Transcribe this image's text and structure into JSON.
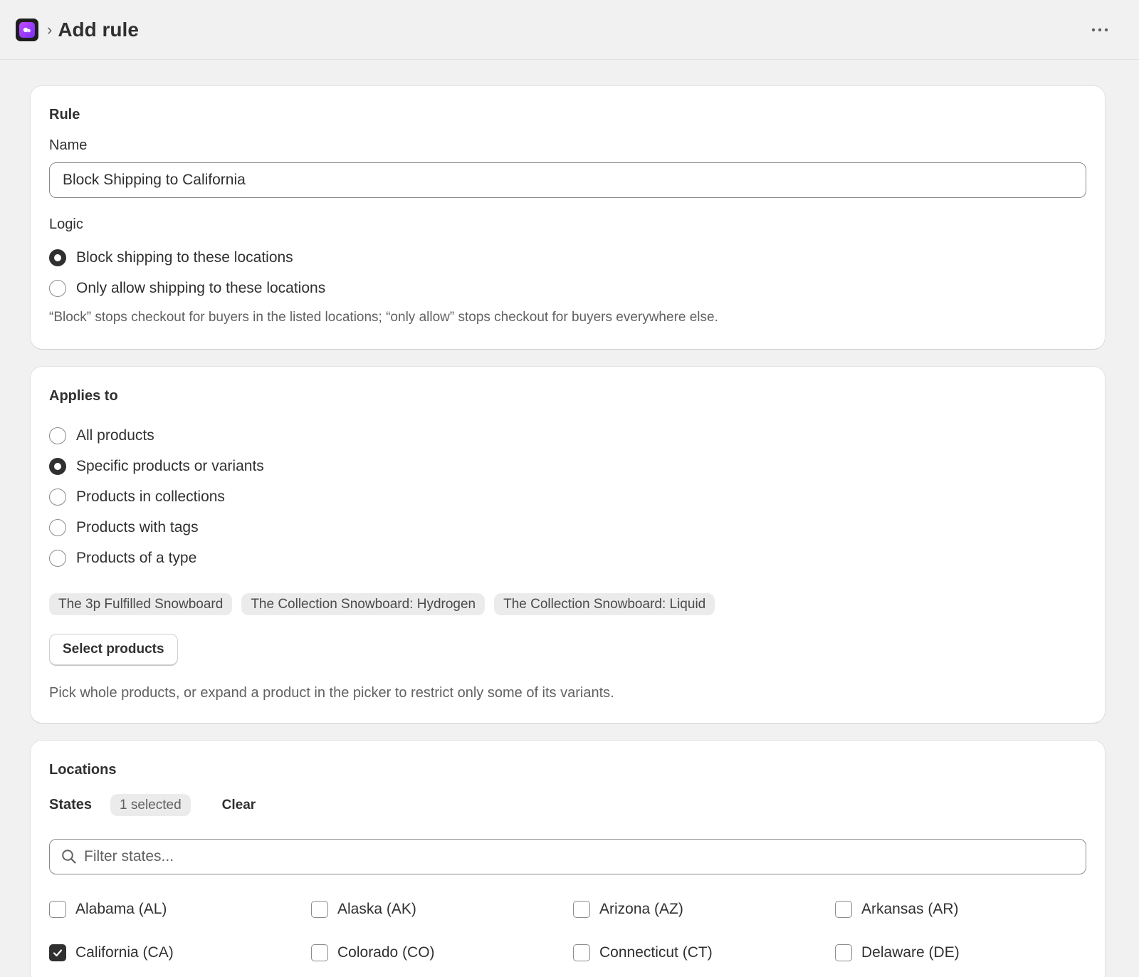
{
  "header": {
    "title": "Add rule",
    "breadcrumb_separator": "›"
  },
  "rule_card": {
    "title": "Rule",
    "name_label": "Name",
    "name_value": "Block Shipping to California",
    "logic_label": "Logic",
    "logic_options": [
      {
        "label": "Block shipping to these locations",
        "selected": true
      },
      {
        "label": "Only allow shipping to these locations",
        "selected": false
      }
    ],
    "logic_help": "“Block” stops checkout for buyers in the listed locations; “only allow” stops checkout for buyers everywhere else."
  },
  "applies_card": {
    "title": "Applies to",
    "options": [
      {
        "label": "All products",
        "selected": false
      },
      {
        "label": "Specific products or variants",
        "selected": true
      },
      {
        "label": "Products in collections",
        "selected": false
      },
      {
        "label": "Products with tags",
        "selected": false
      },
      {
        "label": "Products of a type",
        "selected": false
      }
    ],
    "selected_products": [
      "The 3p Fulfilled Snowboard",
      "The Collection Snowboard: Hydrogen",
      "The Collection Snowboard: Liquid"
    ],
    "select_button": "Select products",
    "help": "Pick whole products, or expand a product in the picker to restrict only some of its variants."
  },
  "locations_card": {
    "title": "Locations",
    "states_label": "States",
    "selected_badge": "1 selected",
    "clear_label": "Clear",
    "filter_placeholder": "Filter states...",
    "states": [
      {
        "label": "Alabama (AL)",
        "checked": false
      },
      {
        "label": "Alaska (AK)",
        "checked": false
      },
      {
        "label": "Arizona (AZ)",
        "checked": false
      },
      {
        "label": "Arkansas (AR)",
        "checked": false
      },
      {
        "label": "California (CA)",
        "checked": true
      },
      {
        "label": "Colorado (CO)",
        "checked": false
      },
      {
        "label": "Connecticut (CT)",
        "checked": false
      },
      {
        "label": "Delaware (DE)",
        "checked": false
      }
    ]
  },
  "colors": {
    "background": "#f1f1f1",
    "card": "#ffffff",
    "text": "#303030",
    "muted": "#616161",
    "chip": "#ebebeb",
    "app_icon_accent": "#9b3cff"
  },
  "icons": {
    "app": "app-icon",
    "more": "ellipsis-horizontal-icon",
    "search": "search-icon",
    "check": "checkmark-icon"
  }
}
